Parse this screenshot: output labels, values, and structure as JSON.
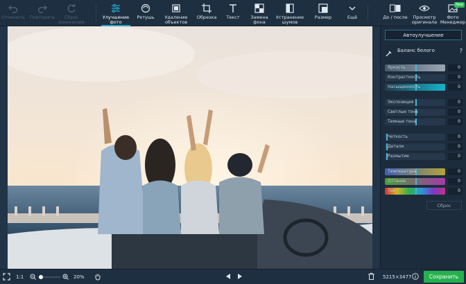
{
  "toolbar": {
    "undo": "Отменить",
    "redo": "Повторить",
    "reset": "Сброс\nизменений",
    "enhance": "Улучшение\nфото",
    "retouch": "Ретушь",
    "remove_objects": "Удаление\nобъектов",
    "crop": "Обрезка",
    "text": "Текст",
    "bg_replace": "Замена\nфона",
    "denoise": "Устранение\nшумов",
    "resize": "Размер",
    "more": "Ещё",
    "before_after": "До / после",
    "view_original": "Просмотр\nоригинала",
    "photo_manager": "Фото\nМенеджер",
    "new_badge": "New"
  },
  "panel": {
    "auto_enhance": "Автоулучшение",
    "white_balance": "Баланс белого",
    "help": "?",
    "sliders": [
      {
        "label": "Яркость",
        "value": "0"
      },
      {
        "label": "Контрастность",
        "value": "0"
      },
      {
        "label": "Насыщенность",
        "value": "0"
      },
      {
        "label": "Экспозиция",
        "value": "0"
      },
      {
        "label": "Светлые тона",
        "value": "0"
      },
      {
        "label": "Темные тона",
        "value": "0"
      },
      {
        "label": "Четкость",
        "value": "0"
      },
      {
        "label": "Детали",
        "value": "0"
      },
      {
        "label": "Размытие",
        "value": "0"
      },
      {
        "label": "Температура",
        "value": "0"
      },
      {
        "label": "Оттенок",
        "value": "0"
      },
      {
        "label": "Тон",
        "value": "0"
      }
    ],
    "reset": "Сброс"
  },
  "bottombar": {
    "ratio": "1:1",
    "zoom": "20%",
    "dimensions": "5215×3477",
    "save": "Сохранить"
  },
  "colors": {
    "accent": "#21a7c7",
    "save_green": "#27b14e"
  }
}
